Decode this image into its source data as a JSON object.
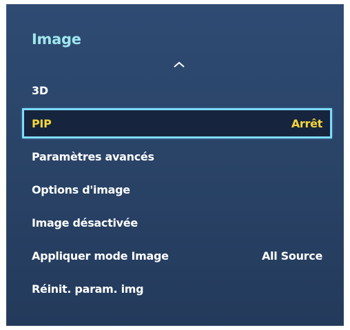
{
  "menu": {
    "title": "Image",
    "items": [
      {
        "label": "3D",
        "value": ""
      },
      {
        "label": "PIP",
        "value": "Arrêt"
      },
      {
        "label": "Paramètres avancés",
        "value": ""
      },
      {
        "label": "Options d'image",
        "value": ""
      },
      {
        "label": "Image désactivée",
        "value": ""
      },
      {
        "label": "Appliquer mode Image",
        "value": "All Source"
      },
      {
        "label": "Réinit. param. img",
        "value": ""
      }
    ]
  },
  "icons": {
    "scroll_up": "chevron-up-icon"
  },
  "colors": {
    "panel_background": "#2a4468",
    "title_color": "#9fe6ee",
    "selected_text": "#f5d53c",
    "selected_background": "#16253d",
    "focus_outline": "#7fdcff"
  }
}
